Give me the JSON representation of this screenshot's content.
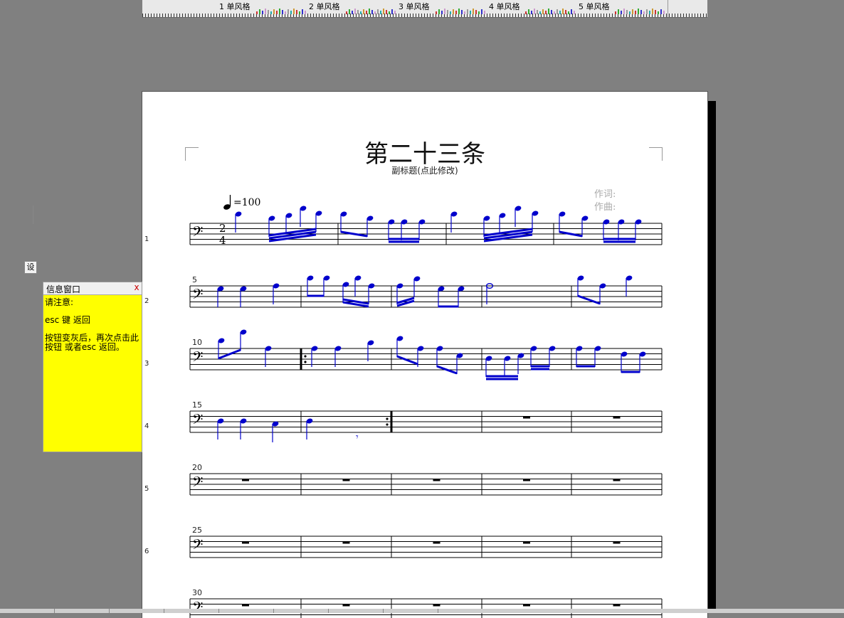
{
  "ruler": {
    "segments": [
      "1 单风格",
      "2 单风格",
      "3 单风格",
      "4 单风格",
      "5 单风格"
    ]
  },
  "score": {
    "title": "第二十三条",
    "subtitle": "副标题(点此修改)",
    "lyricist_label": "作词:",
    "composer_label": "作曲:",
    "tempo": "=100",
    "time_signature": {
      "top": "2",
      "bottom": "4"
    },
    "systems": [
      {
        "number": "1",
        "first_measure": ""
      },
      {
        "number": "2",
        "first_measure": "5"
      },
      {
        "number": "3",
        "first_measure": "10"
      },
      {
        "number": "4",
        "first_measure": "15"
      },
      {
        "number": "5",
        "first_measure": "20"
      },
      {
        "number": "6",
        "first_measure": "25"
      },
      {
        "number": "",
        "first_measure": "30"
      }
    ],
    "note_color": "#0000cc"
  },
  "set_button": {
    "label": "设"
  },
  "info_window": {
    "title": "信息窗口",
    "close": "x",
    "line1": "请注意:",
    "line2": "esc 键 返回",
    "line3": "按钮变灰后，再次点击此按钮 或者esc 返回。"
  }
}
